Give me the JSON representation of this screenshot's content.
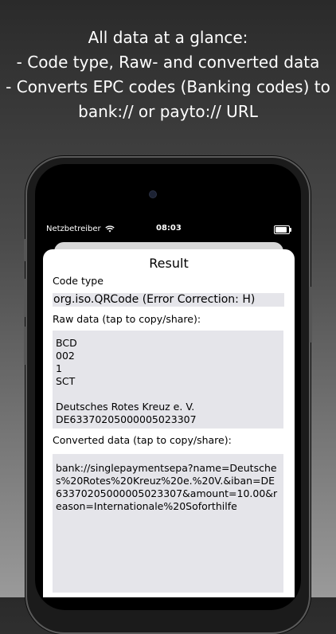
{
  "headline": {
    "line1": "All data at a glance:",
    "line2": "- Code type, Raw- and converted data",
    "line3": "- Converts EPC codes (Banking codes) to",
    "line4": "bank:// or payto:// URL"
  },
  "status_bar": {
    "carrier": "Netzbetreiber",
    "time": "08:03"
  },
  "result": {
    "title": "Result",
    "code_type_label": "Code type",
    "code_type_value": "org.iso.QRCode (Error Correction: H)",
    "raw_label": "Raw data (tap to copy/share):",
    "raw_lines": [
      "BCD",
      "002",
      "1",
      "SCT",
      "",
      "Deutsches Rotes Kreuz e. V.",
      "DE63370205000005023307"
    ],
    "converted_label": "Converted data (tap to copy/share):",
    "converted_value": "bank://singlepaymentsepa?name=Deutsches%20Rotes%20Kreuz%20e.%20V.&iban=DE63370205000005023307&amount=10.00&reason=Internationale%20Soforthilfe"
  }
}
